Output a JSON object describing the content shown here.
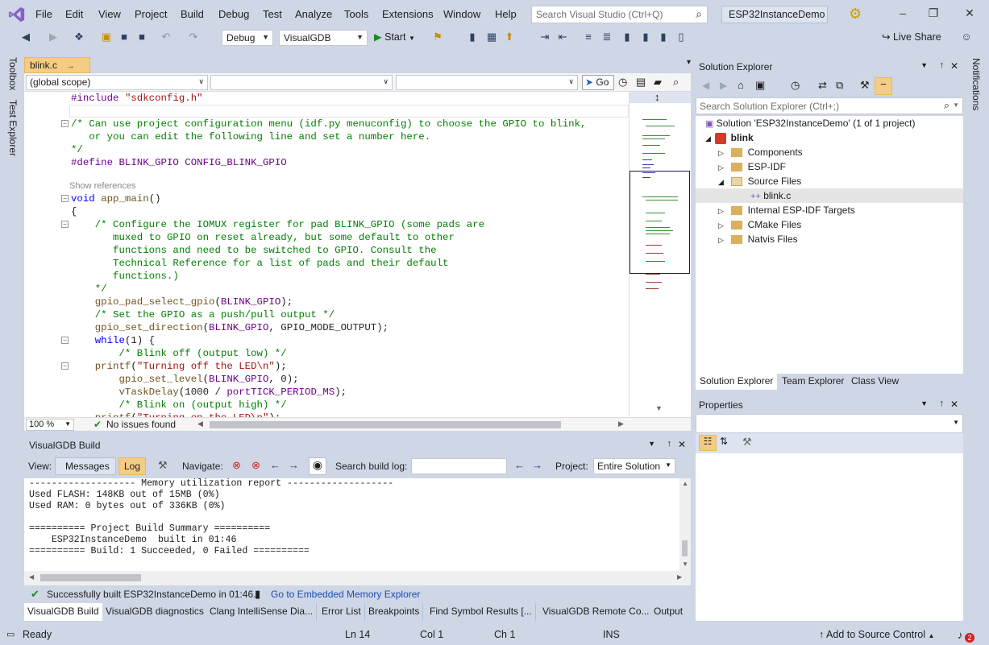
{
  "menubar": {
    "items": [
      "File",
      "Edit",
      "View",
      "Project",
      "Build",
      "Debug",
      "Test",
      "Analyze",
      "Tools",
      "Extensions",
      "Window",
      "Help"
    ],
    "search_placeholder": "Search Visual Studio (Ctrl+Q)",
    "solution_name": "ESP32InstanceDemo"
  },
  "toolbar": {
    "config": "Debug",
    "platform": "VisualGDB",
    "start_label": "Start",
    "live_share": "Live Share"
  },
  "left_tabs": [
    "Toolbox",
    "Test Explorer"
  ],
  "right_tabs": [
    "Notifications"
  ],
  "editor": {
    "tab_name": "blink.c",
    "scope_combo": "(global scope)",
    "go_label": "Go",
    "zoom": "100 %",
    "issues": "No issues found",
    "show_references": "Show references",
    "lines": [
      {
        "segments": [
          {
            "c": "mc",
            "t": "#include"
          },
          {
            "c": "",
            "t": " "
          },
          {
            "c": "st",
            "t": "\"sdkconfig.h\""
          }
        ]
      },
      {
        "segments": []
      },
      {
        "segments": [
          {
            "c": "cm",
            "t": "/* Can use project configuration menu (idf.py menuconfig) to choose the GPIO to blink,"
          }
        ]
      },
      {
        "segments": [
          {
            "c": "cm",
            "t": "   or you can edit the following line and set a number here."
          }
        ]
      },
      {
        "segments": [
          {
            "c": "cm",
            "t": "*/"
          }
        ]
      },
      {
        "segments": [
          {
            "c": "mc",
            "t": "#define"
          },
          {
            "c": "",
            "t": " "
          },
          {
            "c": "mc",
            "t": "BLINK_GPIO CONFIG_BLINK_GPIO"
          }
        ]
      },
      {
        "segments": []
      },
      {
        "segments": [
          {
            "c": "kw",
            "t": "void"
          },
          {
            "c": "",
            "t": " "
          },
          {
            "c": "fn",
            "t": "app_main"
          },
          {
            "c": "",
            "t": "()"
          }
        ]
      },
      {
        "segments": [
          {
            "c": "",
            "t": "{"
          }
        ]
      },
      {
        "segments": [
          {
            "c": "cm",
            "t": "    /* Configure the IOMUX register for pad BLINK_GPIO (some pads are"
          }
        ]
      },
      {
        "segments": [
          {
            "c": "cm",
            "t": "       muxed to GPIO on reset already, but some default to other"
          }
        ]
      },
      {
        "segments": [
          {
            "c": "cm",
            "t": "       functions and need to be switched to GPIO. Consult the"
          }
        ]
      },
      {
        "segments": [
          {
            "c": "cm",
            "t": "       Technical Reference for a list of pads and their default"
          }
        ]
      },
      {
        "segments": [
          {
            "c": "cm",
            "t": "       functions.)"
          }
        ]
      },
      {
        "segments": [
          {
            "c": "cm",
            "t": "    */"
          }
        ]
      },
      {
        "segments": [
          {
            "c": "",
            "t": "    "
          },
          {
            "c": "fn",
            "t": "gpio_pad_select_gpio"
          },
          {
            "c": "",
            "t": "("
          },
          {
            "c": "mc",
            "t": "BLINK_GPIO"
          },
          {
            "c": "",
            "t": ");"
          }
        ]
      },
      {
        "segments": [
          {
            "c": "cm",
            "t": "    /* Set the GPIO as a push/pull output */"
          }
        ]
      },
      {
        "segments": [
          {
            "c": "",
            "t": "    "
          },
          {
            "c": "fn",
            "t": "gpio_set_direction"
          },
          {
            "c": "",
            "t": "("
          },
          {
            "c": "mc",
            "t": "BLINK_GPIO"
          },
          {
            "c": "",
            "t": ", GPIO_MODE_OUTPUT);"
          }
        ]
      },
      {
        "segments": [
          {
            "c": "",
            "t": "    "
          },
          {
            "c": "kw",
            "t": "while"
          },
          {
            "c": "",
            "t": "(1) {"
          }
        ]
      },
      {
        "segments": [
          {
            "c": "cm",
            "t": "        /* Blink off (output low) */"
          }
        ]
      },
      {
        "segments": [
          {
            "c": "",
            "t": "    "
          },
          {
            "c": "fn",
            "t": "printf"
          },
          {
            "c": "",
            "t": "("
          },
          {
            "c": "st",
            "t": "\"Turning off the LED\\n\""
          },
          {
            "c": "",
            "t": ");"
          }
        ]
      },
      {
        "segments": [
          {
            "c": "",
            "t": "        "
          },
          {
            "c": "fn",
            "t": "gpio_set_level"
          },
          {
            "c": "",
            "t": "("
          },
          {
            "c": "mc",
            "t": "BLINK_GPIO"
          },
          {
            "c": "",
            "t": ", 0);"
          }
        ]
      },
      {
        "segments": [
          {
            "c": "",
            "t": "        "
          },
          {
            "c": "fn",
            "t": "vTaskDelay"
          },
          {
            "c": "",
            "t": "(1000 / "
          },
          {
            "c": "mc",
            "t": "portTICK_PERIOD_MS"
          },
          {
            "c": "",
            "t": ");"
          }
        ]
      },
      {
        "segments": [
          {
            "c": "cm",
            "t": "        /* Blink on (output high) */"
          }
        ]
      },
      {
        "segments": [
          {
            "c": "",
            "t": "    "
          },
          {
            "c": "fn",
            "t": "printf"
          },
          {
            "c": "",
            "t": "("
          },
          {
            "c": "st",
            "t": "\"Turning on the LED\\n\""
          },
          {
            "c": "",
            "t": ");"
          }
        ]
      }
    ]
  },
  "build_panel": {
    "title": "VisualGDB Build",
    "view_label": "View:",
    "messages_label": "Messages",
    "log_label": "Log",
    "navigate_label": "Navigate:",
    "search_label": "Search build log:",
    "project_label": "Project:",
    "project_value": "Entire Solution",
    "log_lines": [
      "------------------- Memory utilization report -------------------",
      "Used FLASH: 148KB out of 15MB (0%)",
      "Used RAM: 0 bytes out of 336KB (0%)",
      "",
      "========== Project Build Summary ==========",
      "    ESP32InstanceDemo  built in 01:46",
      "========== Build: 1 Succeeded, 0 Failed =========="
    ],
    "status_text": "Successfully built ESP32InstanceDemo in 01:46.",
    "memory_link": "Go to Embedded Memory Explorer"
  },
  "bottom_tabs": [
    "VisualGDB Build",
    "VisualGDB diagnostics",
    "Clang IntelliSense Dia...",
    "Error List",
    "Breakpoints",
    "Find Symbol Results [...",
    "VisualGDB Remote Co...",
    "Output"
  ],
  "solution_explorer": {
    "title": "Solution Explorer",
    "search_placeholder": "Search Solution Explorer (Ctrl+;)",
    "solution_label": "Solution 'ESP32InstanceDemo' (1 of 1 project)",
    "project": "blink",
    "nodes": [
      "Components",
      "ESP-IDF",
      "Source Files",
      "blink.c",
      "Internal ESP-IDF Targets",
      "CMake Files",
      "Natvis Files"
    ],
    "tabs": [
      "Solution Explorer",
      "Team Explorer",
      "Class View"
    ]
  },
  "properties": {
    "title": "Properties"
  },
  "statusbar": {
    "ready": "Ready",
    "ln": "Ln 14",
    "col": "Col 1",
    "ch": "Ch 1",
    "ins": "INS",
    "source_control": "Add to Source Control",
    "notif_count": "2"
  }
}
